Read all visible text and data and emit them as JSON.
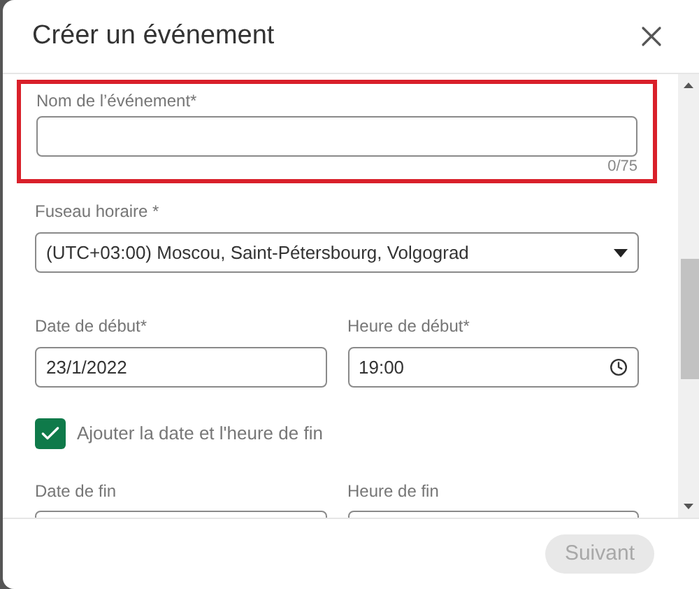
{
  "dialog": {
    "title": "Créer un événement"
  },
  "name_field": {
    "label": "Nom de l’événement*",
    "counter": "0/75",
    "highlighted": true
  },
  "timezone": {
    "label": "Fuseau horaire *",
    "value": "(UTC+03:00) Moscou, Saint-Pétersbourg, Volgograd"
  },
  "start": {
    "date_label": "Date de début*",
    "date": "23/1/2022",
    "time_label": "Heure de début*",
    "time": "19:00"
  },
  "end_option": {
    "label": "Ajouter la date et l'heure de fin",
    "checked": true
  },
  "end": {
    "date_label": "Date de fin",
    "time_label": "Heure de fin"
  },
  "footer": {
    "button": "Suivant",
    "disabled": true
  }
}
